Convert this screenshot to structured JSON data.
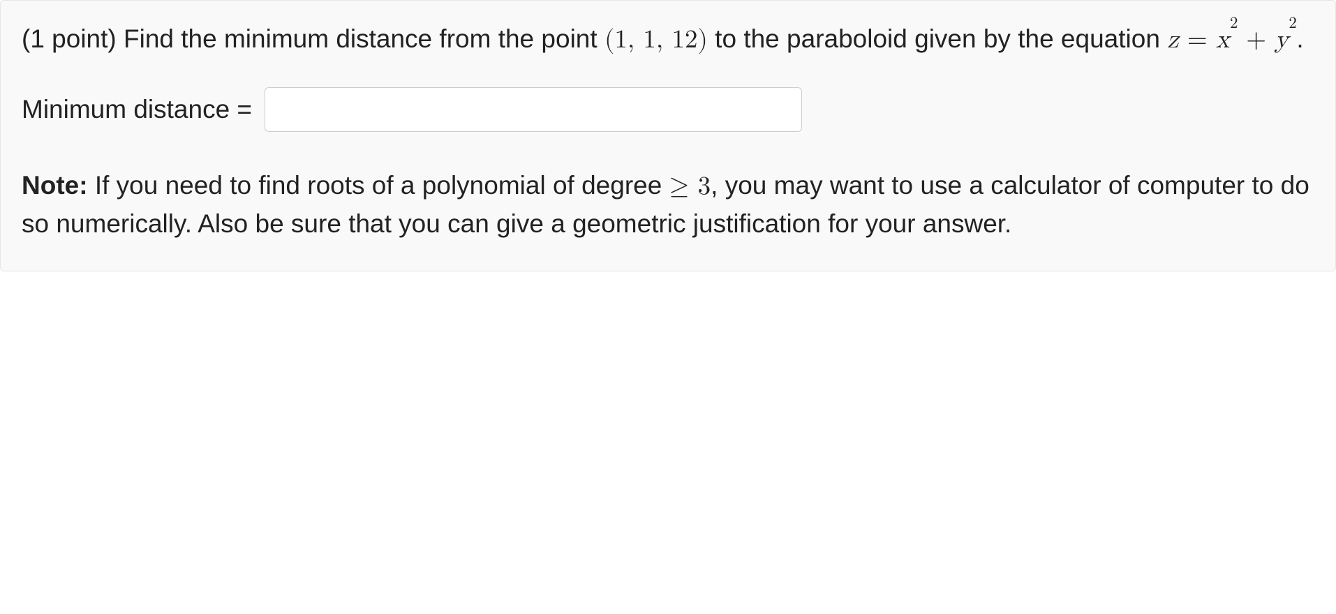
{
  "problem": {
    "points_prefix": "(1 point) ",
    "text_part1": "Find the minimum distance from the point ",
    "point_open": "(",
    "point_a": "1",
    "point_sep1": ", ",
    "point_b": "1",
    "point_sep2": ", ",
    "point_c": "12",
    "point_close": ")",
    "text_part2": " to the paraboloid given by the equation ",
    "eq_z": "z",
    "eq_equals": " = ",
    "eq_x": "x",
    "eq_x_exp": "2",
    "eq_plus": " + ",
    "eq_y": "y",
    "eq_y_exp": "2",
    "eq_period": "."
  },
  "answer": {
    "label": "Minimum distance =",
    "value": "",
    "placeholder": ""
  },
  "note": {
    "bold_label": "Note:",
    "text_part1": " If you need to find roots of a polynomial of degree ",
    "ge": "≥",
    "three": " 3",
    "text_part2": ", you may want to use a calculator of computer to do so numerically. Also be sure that you can give a geometric justification for your answer."
  }
}
